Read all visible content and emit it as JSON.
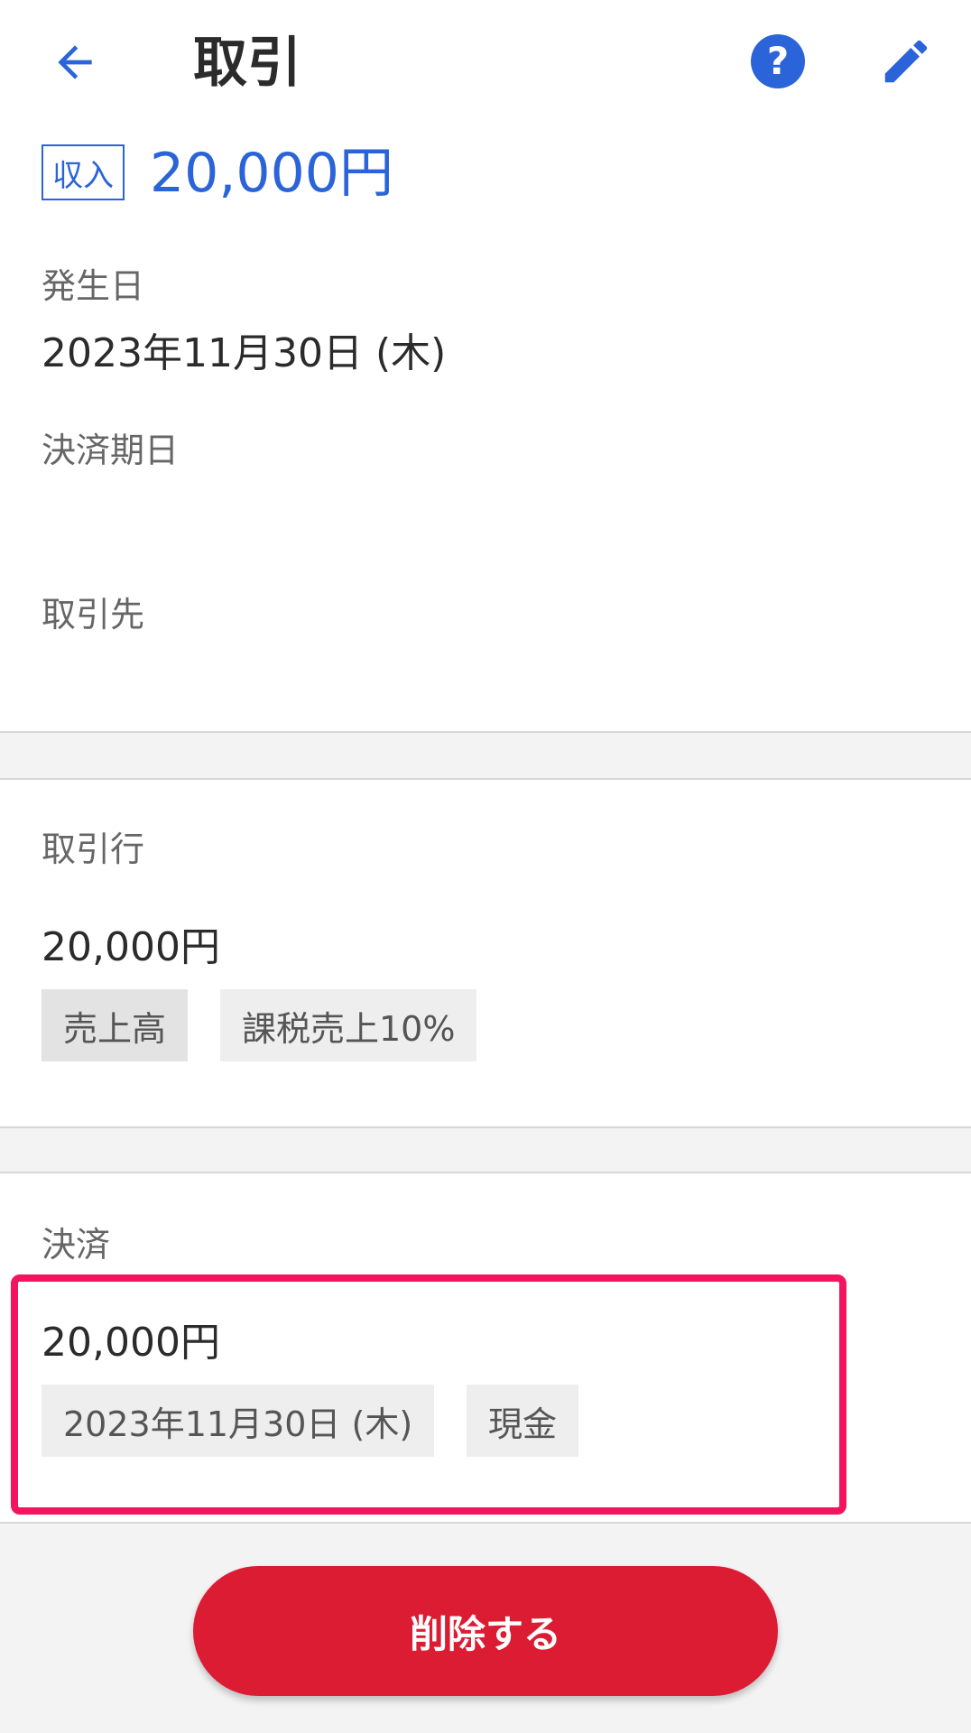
{
  "header": {
    "title": "取引",
    "back_icon": "arrow-left-icon",
    "help_icon": "question-circle-icon",
    "edit_icon": "pencil-icon",
    "type_badge": "収入",
    "amount": "20,000円",
    "accent_color": "#2a64d8"
  },
  "details": {
    "occurrence_label": "発生日",
    "occurrence_value": "2023年11月30日 (木)",
    "due_label": "決済期日",
    "due_value": "",
    "partner_label": "取引先",
    "partner_value": ""
  },
  "lines": {
    "label": "取引行",
    "amount": "20,000円",
    "account_tag": "売上高",
    "tax_tag": "課税売上10%"
  },
  "payment": {
    "label": "決済",
    "amount": "20,000円",
    "date_tag": "2023年11月30日 (木)",
    "method_tag": "現金",
    "highlight_color": "#f4145e"
  },
  "actions": {
    "delete_label": "削除する",
    "delete_color": "#dc1c33"
  }
}
